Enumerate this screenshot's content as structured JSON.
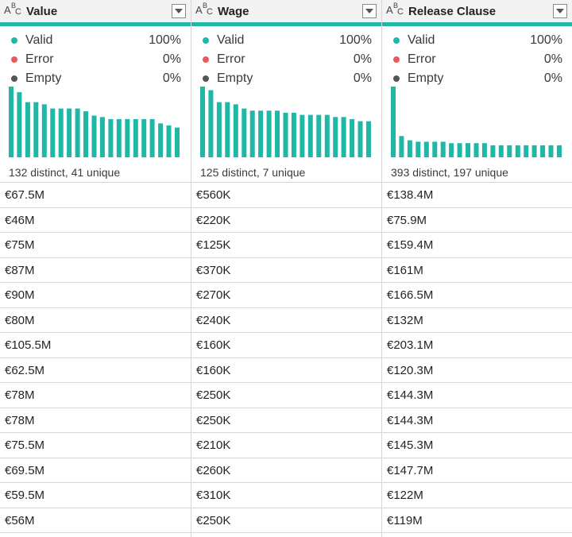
{
  "colors": {
    "accent": "#1fb7a6",
    "valid": "#1fb7a6",
    "error": "#e85b5b",
    "empty": "#555555"
  },
  "columns": [
    {
      "name": "Value",
      "type_icon": "abc-type-icon",
      "stats": {
        "valid_label": "Valid",
        "valid_pct": "100%",
        "error_label": "Error",
        "error_pct": "0%",
        "empty_label": "Empty",
        "empty_pct": "0%"
      },
      "histogram": [
        1.0,
        0.92,
        0.78,
        0.78,
        0.75,
        0.69,
        0.69,
        0.69,
        0.69,
        0.65,
        0.59,
        0.57,
        0.54,
        0.54,
        0.54,
        0.54,
        0.54,
        0.54,
        0.48,
        0.45,
        0.42
      ],
      "summary": "132 distinct, 41 unique",
      "rows": [
        "€67.5M",
        "€46M",
        "€75M",
        "€87M",
        "€90M",
        "€80M",
        "€105.5M",
        "€62.5M",
        "€78M",
        "€78M",
        "€75.5M",
        "€69.5M",
        "€59.5M",
        "€56M"
      ]
    },
    {
      "name": "Wage",
      "type_icon": "abc-type-icon",
      "stats": {
        "valid_label": "Valid",
        "valid_pct": "100%",
        "error_label": "Error",
        "error_pct": "0%",
        "empty_label": "Empty",
        "empty_pct": "0%"
      },
      "histogram": [
        1.0,
        0.95,
        0.78,
        0.78,
        0.75,
        0.69,
        0.66,
        0.66,
        0.66,
        0.66,
        0.63,
        0.63,
        0.6,
        0.6,
        0.6,
        0.6,
        0.57,
        0.57,
        0.54,
        0.51,
        0.51
      ],
      "summary": "125 distinct, 7 unique",
      "rows": [
        "€560K",
        "€220K",
        "€125K",
        "€370K",
        "€270K",
        "€240K",
        "€160K",
        "€160K",
        "€250K",
        "€250K",
        "€210K",
        "€260K",
        "€310K",
        "€250K"
      ]
    },
    {
      "name": "Release Clause",
      "type_icon": "abc-type-icon",
      "stats": {
        "valid_label": "Valid",
        "valid_pct": "100%",
        "error_label": "Error",
        "error_pct": "0%",
        "empty_label": "Empty",
        "empty_pct": "0%"
      },
      "histogram": [
        1.0,
        0.3,
        0.24,
        0.22,
        0.22,
        0.22,
        0.22,
        0.2,
        0.2,
        0.2,
        0.2,
        0.2,
        0.17,
        0.17,
        0.17,
        0.17,
        0.17,
        0.17,
        0.17,
        0.17,
        0.17
      ],
      "summary": "393 distinct, 197 unique",
      "rows": [
        "€138.4M",
        "€75.9M",
        "€159.4M",
        "€161M",
        "€166.5M",
        "€132M",
        "€203.1M",
        "€120.3M",
        "€144.3M",
        "€144.3M",
        "€145.3M",
        "€147.7M",
        "€122M",
        "€119M"
      ]
    }
  ]
}
